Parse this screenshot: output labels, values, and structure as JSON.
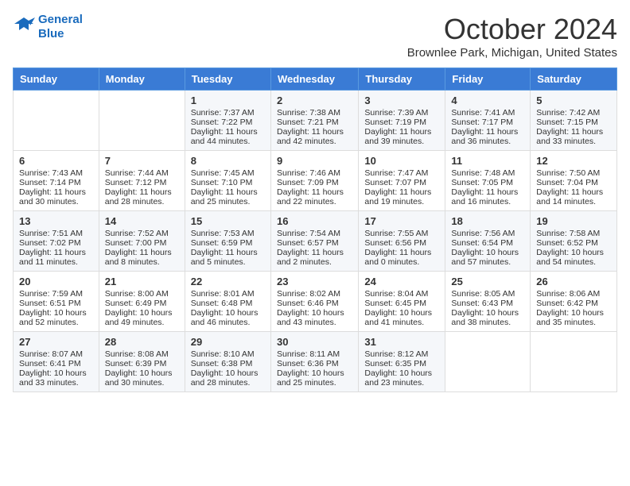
{
  "header": {
    "logo_line1": "General",
    "logo_line2": "Blue",
    "month": "October 2024",
    "location": "Brownlee Park, Michigan, United States"
  },
  "days_of_week": [
    "Sunday",
    "Monday",
    "Tuesday",
    "Wednesday",
    "Thursday",
    "Friday",
    "Saturday"
  ],
  "weeks": [
    [
      {
        "day": "",
        "sunrise": "",
        "sunset": "",
        "daylight": ""
      },
      {
        "day": "",
        "sunrise": "",
        "sunset": "",
        "daylight": ""
      },
      {
        "day": "1",
        "sunrise": "Sunrise: 7:37 AM",
        "sunset": "Sunset: 7:22 PM",
        "daylight": "Daylight: 11 hours and 44 minutes."
      },
      {
        "day": "2",
        "sunrise": "Sunrise: 7:38 AM",
        "sunset": "Sunset: 7:21 PM",
        "daylight": "Daylight: 11 hours and 42 minutes."
      },
      {
        "day": "3",
        "sunrise": "Sunrise: 7:39 AM",
        "sunset": "Sunset: 7:19 PM",
        "daylight": "Daylight: 11 hours and 39 minutes."
      },
      {
        "day": "4",
        "sunrise": "Sunrise: 7:41 AM",
        "sunset": "Sunset: 7:17 PM",
        "daylight": "Daylight: 11 hours and 36 minutes."
      },
      {
        "day": "5",
        "sunrise": "Sunrise: 7:42 AM",
        "sunset": "Sunset: 7:15 PM",
        "daylight": "Daylight: 11 hours and 33 minutes."
      }
    ],
    [
      {
        "day": "6",
        "sunrise": "Sunrise: 7:43 AM",
        "sunset": "Sunset: 7:14 PM",
        "daylight": "Daylight: 11 hours and 30 minutes."
      },
      {
        "day": "7",
        "sunrise": "Sunrise: 7:44 AM",
        "sunset": "Sunset: 7:12 PM",
        "daylight": "Daylight: 11 hours and 28 minutes."
      },
      {
        "day": "8",
        "sunrise": "Sunrise: 7:45 AM",
        "sunset": "Sunset: 7:10 PM",
        "daylight": "Daylight: 11 hours and 25 minutes."
      },
      {
        "day": "9",
        "sunrise": "Sunrise: 7:46 AM",
        "sunset": "Sunset: 7:09 PM",
        "daylight": "Daylight: 11 hours and 22 minutes."
      },
      {
        "day": "10",
        "sunrise": "Sunrise: 7:47 AM",
        "sunset": "Sunset: 7:07 PM",
        "daylight": "Daylight: 11 hours and 19 minutes."
      },
      {
        "day": "11",
        "sunrise": "Sunrise: 7:48 AM",
        "sunset": "Sunset: 7:05 PM",
        "daylight": "Daylight: 11 hours and 16 minutes."
      },
      {
        "day": "12",
        "sunrise": "Sunrise: 7:50 AM",
        "sunset": "Sunset: 7:04 PM",
        "daylight": "Daylight: 11 hours and 14 minutes."
      }
    ],
    [
      {
        "day": "13",
        "sunrise": "Sunrise: 7:51 AM",
        "sunset": "Sunset: 7:02 PM",
        "daylight": "Daylight: 11 hours and 11 minutes."
      },
      {
        "day": "14",
        "sunrise": "Sunrise: 7:52 AM",
        "sunset": "Sunset: 7:00 PM",
        "daylight": "Daylight: 11 hours and 8 minutes."
      },
      {
        "day": "15",
        "sunrise": "Sunrise: 7:53 AM",
        "sunset": "Sunset: 6:59 PM",
        "daylight": "Daylight: 11 hours and 5 minutes."
      },
      {
        "day": "16",
        "sunrise": "Sunrise: 7:54 AM",
        "sunset": "Sunset: 6:57 PM",
        "daylight": "Daylight: 11 hours and 2 minutes."
      },
      {
        "day": "17",
        "sunrise": "Sunrise: 7:55 AM",
        "sunset": "Sunset: 6:56 PM",
        "daylight": "Daylight: 11 hours and 0 minutes."
      },
      {
        "day": "18",
        "sunrise": "Sunrise: 7:56 AM",
        "sunset": "Sunset: 6:54 PM",
        "daylight": "Daylight: 10 hours and 57 minutes."
      },
      {
        "day": "19",
        "sunrise": "Sunrise: 7:58 AM",
        "sunset": "Sunset: 6:52 PM",
        "daylight": "Daylight: 10 hours and 54 minutes."
      }
    ],
    [
      {
        "day": "20",
        "sunrise": "Sunrise: 7:59 AM",
        "sunset": "Sunset: 6:51 PM",
        "daylight": "Daylight: 10 hours and 52 minutes."
      },
      {
        "day": "21",
        "sunrise": "Sunrise: 8:00 AM",
        "sunset": "Sunset: 6:49 PM",
        "daylight": "Daylight: 10 hours and 49 minutes."
      },
      {
        "day": "22",
        "sunrise": "Sunrise: 8:01 AM",
        "sunset": "Sunset: 6:48 PM",
        "daylight": "Daylight: 10 hours and 46 minutes."
      },
      {
        "day": "23",
        "sunrise": "Sunrise: 8:02 AM",
        "sunset": "Sunset: 6:46 PM",
        "daylight": "Daylight: 10 hours and 43 minutes."
      },
      {
        "day": "24",
        "sunrise": "Sunrise: 8:04 AM",
        "sunset": "Sunset: 6:45 PM",
        "daylight": "Daylight: 10 hours and 41 minutes."
      },
      {
        "day": "25",
        "sunrise": "Sunrise: 8:05 AM",
        "sunset": "Sunset: 6:43 PM",
        "daylight": "Daylight: 10 hours and 38 minutes."
      },
      {
        "day": "26",
        "sunrise": "Sunrise: 8:06 AM",
        "sunset": "Sunset: 6:42 PM",
        "daylight": "Daylight: 10 hours and 35 minutes."
      }
    ],
    [
      {
        "day": "27",
        "sunrise": "Sunrise: 8:07 AM",
        "sunset": "Sunset: 6:41 PM",
        "daylight": "Daylight: 10 hours and 33 minutes."
      },
      {
        "day": "28",
        "sunrise": "Sunrise: 8:08 AM",
        "sunset": "Sunset: 6:39 PM",
        "daylight": "Daylight: 10 hours and 30 minutes."
      },
      {
        "day": "29",
        "sunrise": "Sunrise: 8:10 AM",
        "sunset": "Sunset: 6:38 PM",
        "daylight": "Daylight: 10 hours and 28 minutes."
      },
      {
        "day": "30",
        "sunrise": "Sunrise: 8:11 AM",
        "sunset": "Sunset: 6:36 PM",
        "daylight": "Daylight: 10 hours and 25 minutes."
      },
      {
        "day": "31",
        "sunrise": "Sunrise: 8:12 AM",
        "sunset": "Sunset: 6:35 PM",
        "daylight": "Daylight: 10 hours and 23 minutes."
      },
      {
        "day": "",
        "sunrise": "",
        "sunset": "",
        "daylight": ""
      },
      {
        "day": "",
        "sunrise": "",
        "sunset": "",
        "daylight": ""
      }
    ]
  ]
}
